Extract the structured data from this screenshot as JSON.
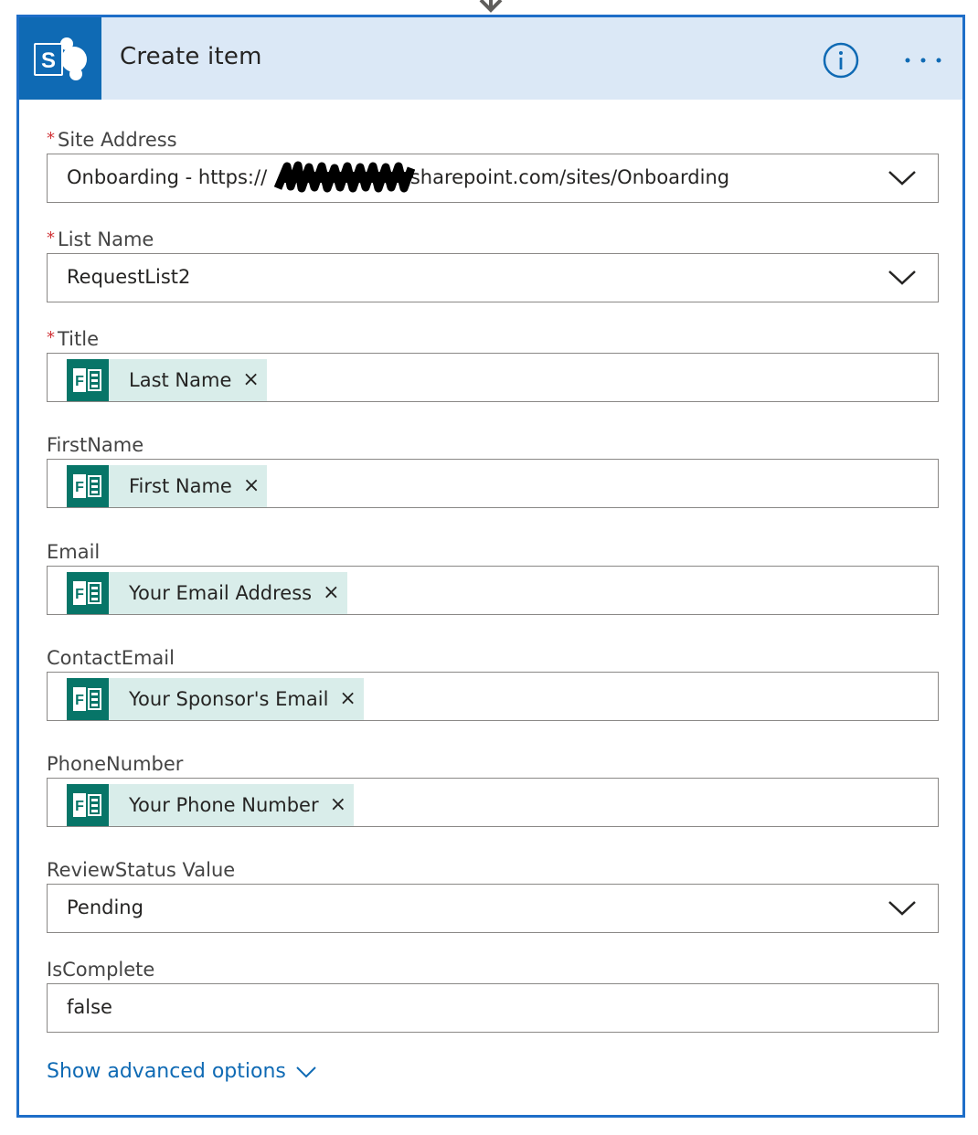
{
  "header": {
    "title": "Create item",
    "service_icon": "sharepoint-icon",
    "sharepoint_letter": "S",
    "info_icon": "info-icon",
    "more_icon": "more-icon"
  },
  "fields": {
    "site_address": {
      "label": "Site Address",
      "required_mark": "*",
      "value_prefix": "Onboarding - https://",
      "value_suffix": ".sharepoint.com/sites/Onboarding"
    },
    "list_name": {
      "label": "List Name",
      "required_mark": "*",
      "value": "RequestList2"
    },
    "title": {
      "label": "Title",
      "required_mark": "*",
      "token": "Last Name"
    },
    "first_name": {
      "label": "FirstName",
      "token": "First Name"
    },
    "email": {
      "label": "Email",
      "token": "Your Email Address"
    },
    "contact_email": {
      "label": "ContactEmail",
      "token": "Your Sponsor's Email"
    },
    "phone_number": {
      "label": "PhoneNumber",
      "token": "Your Phone Number"
    },
    "review_status": {
      "label": "ReviewStatus Value",
      "value": "Pending"
    },
    "is_complete": {
      "label": "IsComplete",
      "value": "false"
    }
  },
  "token_remove_glyph": "×",
  "forms_icon_letter": "F",
  "advanced_link": "Show advanced options",
  "colors": {
    "card_border": "#1e6ec8",
    "header_bg": "#dbe8f6",
    "sharepoint_blue": "#0f6ab4",
    "forms_green": "#077568",
    "token_bg": "#d9edea",
    "required_red": "#d13438",
    "link_blue": "#0f6ab4"
  }
}
